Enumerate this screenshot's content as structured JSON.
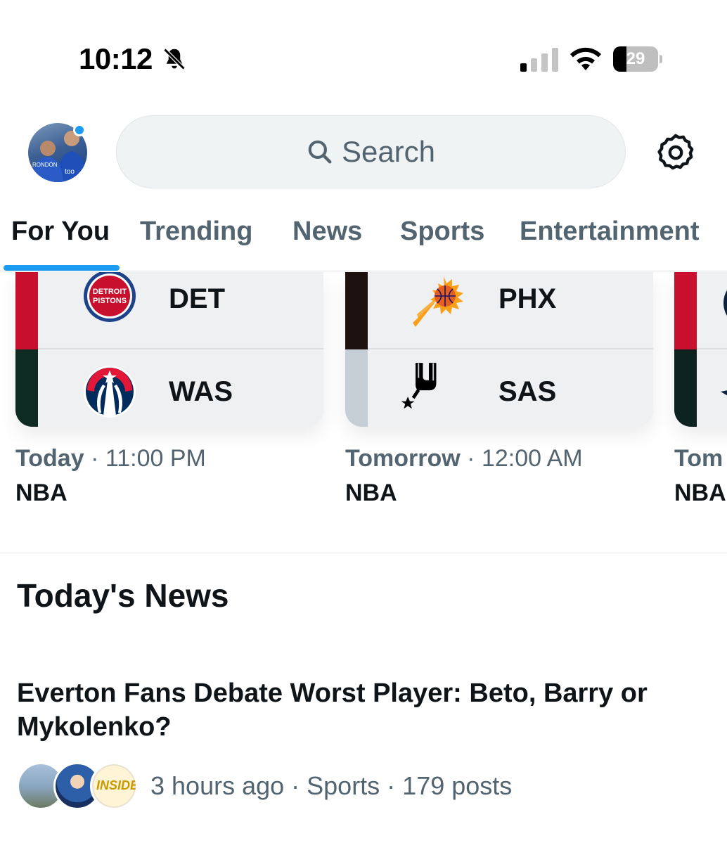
{
  "status_bar": {
    "time": "10:12",
    "battery_level": "29",
    "battery_fraction": 0.29
  },
  "header": {
    "search_placeholder": "Search"
  },
  "tabs": [
    {
      "label": "For You",
      "active": true
    },
    {
      "label": "Trending",
      "active": false
    },
    {
      "label": "News",
      "active": false
    },
    {
      "label": "Sports",
      "active": false
    },
    {
      "label": "Entertainment",
      "active": false
    }
  ],
  "games": [
    {
      "home": {
        "abbr": "DET",
        "logo": "detroit-pistons-logo",
        "color": "#c8102e"
      },
      "away": {
        "abbr": "WAS",
        "logo": "washington-wizards-logo",
        "color": "#0e2b23"
      },
      "day": "Today",
      "time": "11:00 PM",
      "league": "NBA"
    },
    {
      "home": {
        "abbr": "PHX",
        "logo": "phoenix-suns-logo",
        "color": "#1d1210"
      },
      "away": {
        "abbr": "SAS",
        "logo": "san-antonio-spurs-logo",
        "color": "#c4ced4"
      },
      "day": "Tomorrow",
      "time": "12:00 AM",
      "league": "NBA"
    },
    {
      "home": {
        "abbr": "",
        "logo": "team-logo",
        "color": "#c8102e"
      },
      "away": {
        "abbr": "",
        "logo": "team-logo",
        "color": "#0c2320"
      },
      "day": "Tom",
      "time": "",
      "league": "NBA"
    }
  ],
  "news": {
    "section_title": "Today's News",
    "items": [
      {
        "headline": "Everton Fans Debate Worst Player: Beto, Barry or Mykolenko?",
        "meta": "3 hours ago · Sports · 179 posts",
        "facepile_badge": "INSIDE"
      }
    ]
  },
  "colors": {
    "accent": "#1d9bf0",
    "text_primary": "#0f1419",
    "text_secondary": "#536471"
  }
}
